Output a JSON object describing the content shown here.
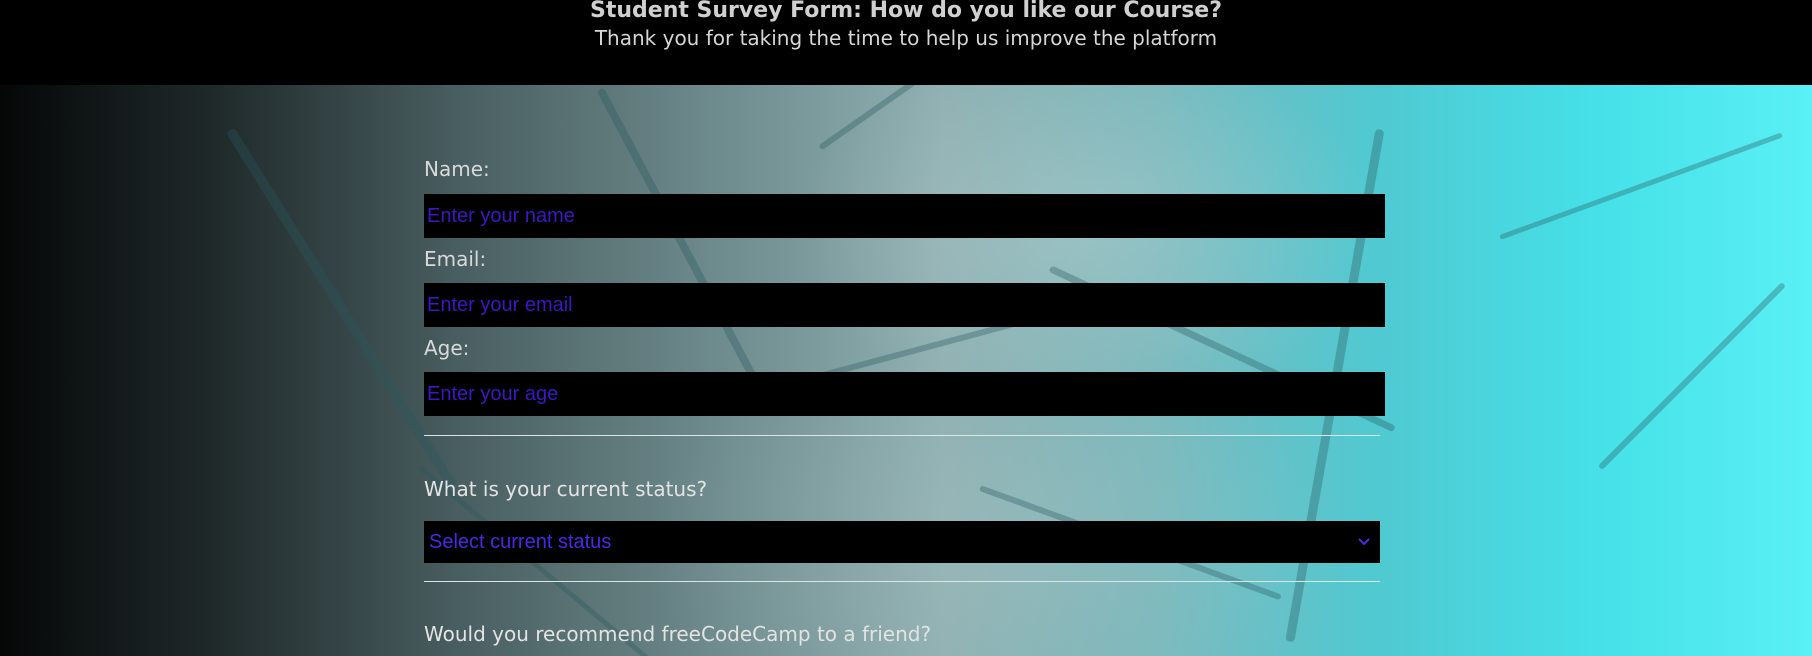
{
  "header": {
    "title": "Student Survey Form: How do you like our Course?",
    "description": "Thank you for taking the time to help us improve the platform"
  },
  "form": {
    "name": {
      "label": "Name:",
      "placeholder": "Enter your name"
    },
    "email": {
      "label": "Email:",
      "placeholder": "Enter your email"
    },
    "age": {
      "label": "Age:",
      "placeholder": "Enter your age"
    },
    "status": {
      "question": "What is your current status?",
      "selected": "Select current status",
      "icon": "chevron-down-icon"
    },
    "recommend": {
      "question": "Would you recommend freeCodeCamp to a friend?"
    }
  },
  "colors": {
    "header_bg": "#000000",
    "field_bg": "#000000",
    "placeholder": "#3f16c4",
    "label_text": "#d9d9d9"
  }
}
